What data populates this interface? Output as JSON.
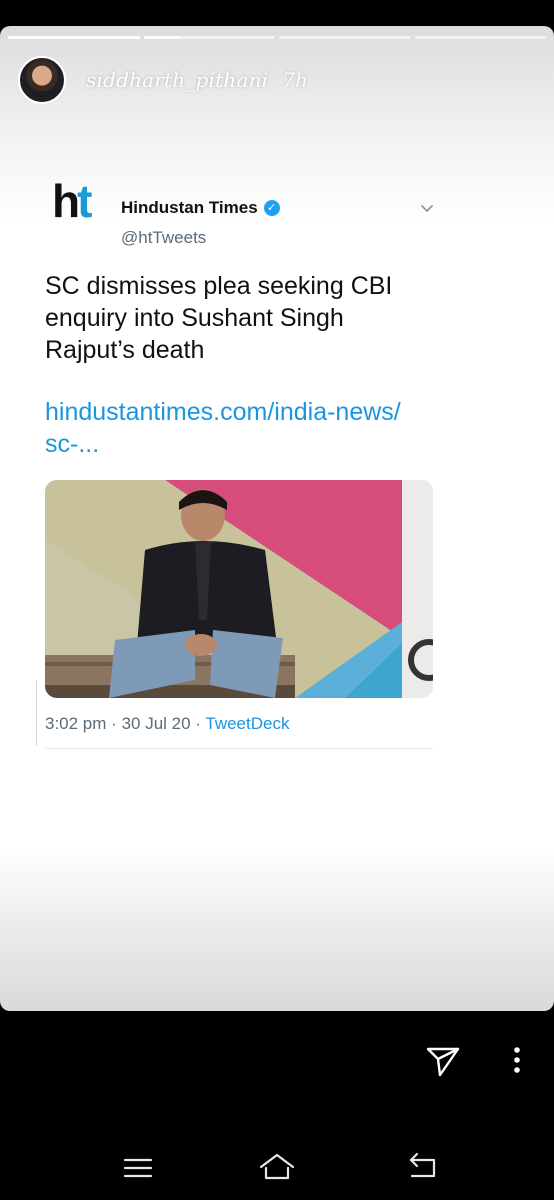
{
  "story": {
    "progress": [
      1.0,
      0.28,
      0.0,
      0.0
    ],
    "username": "siddharth_pithani",
    "time": "7h"
  },
  "tweet": {
    "logo_h": "h",
    "logo_t": "t",
    "author_name": "Hindustan Times",
    "handle": "@htTweets",
    "text": "SC dismisses plea seeking CBI enquiry into Sushant Singh Rajput’s death",
    "link_line1": "hindustantimes.com/india-news/",
    "link_line2": "sc-...",
    "time": "3:02 pm",
    "date": "30 Jul 20",
    "source": "TweetDeck"
  },
  "icons": {
    "send": "send-icon",
    "more": "more-vertical-icon",
    "nav_menu": "menu-icon",
    "nav_home": "home-icon",
    "nav_back": "back-icon"
  },
  "colors": {
    "link": "#1b95e0",
    "verified": "#1da1f2",
    "ht_blue": "#1c9ad6"
  }
}
